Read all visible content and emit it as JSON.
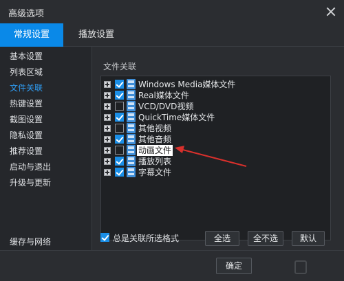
{
  "window": {
    "title": "高级选项"
  },
  "tabs": [
    {
      "label": "常规设置",
      "active": true
    },
    {
      "label": "播放设置",
      "active": false
    }
  ],
  "sidebar": {
    "items": [
      {
        "label": "基本设置",
        "active": false
      },
      {
        "label": "列表区域",
        "active": false
      },
      {
        "label": "文件关联",
        "active": true
      },
      {
        "label": "热键设置",
        "active": false
      },
      {
        "label": "截图设置",
        "active": false
      },
      {
        "label": "隐私设置",
        "active": false
      },
      {
        "label": "推荐设置",
        "active": false
      },
      {
        "label": "启动与退出",
        "active": false
      },
      {
        "label": "升级与更新",
        "active": false
      }
    ],
    "bottom_item": "缓存与网络"
  },
  "main": {
    "section_label": "文件关联",
    "rows": [
      {
        "label": "Windows Media媒体文件",
        "checked": true
      },
      {
        "label": "Real媒体文件",
        "checked": true
      },
      {
        "label": "VCD/DVD视频",
        "checked": false
      },
      {
        "label": "QuickTime媒体文件",
        "checked": true
      },
      {
        "label": "其他视频",
        "checked": false
      },
      {
        "label": "其他音频",
        "checked": true
      },
      {
        "label": "动画文件",
        "checked": false,
        "highlighted": true
      },
      {
        "label": "播放列表",
        "checked": true
      },
      {
        "label": "字幕文件",
        "checked": true
      }
    ],
    "always_associate_label": "总是关联所选格式",
    "always_associate_checked": true,
    "buttons": {
      "select_all": "全选",
      "select_none": "全不选",
      "default": "默认"
    }
  },
  "footer": {
    "ok_label": "确定"
  },
  "colors": {
    "accent": "#0a89e8",
    "background": "#2b2d31",
    "annotation_arrow": "#d9302c"
  }
}
